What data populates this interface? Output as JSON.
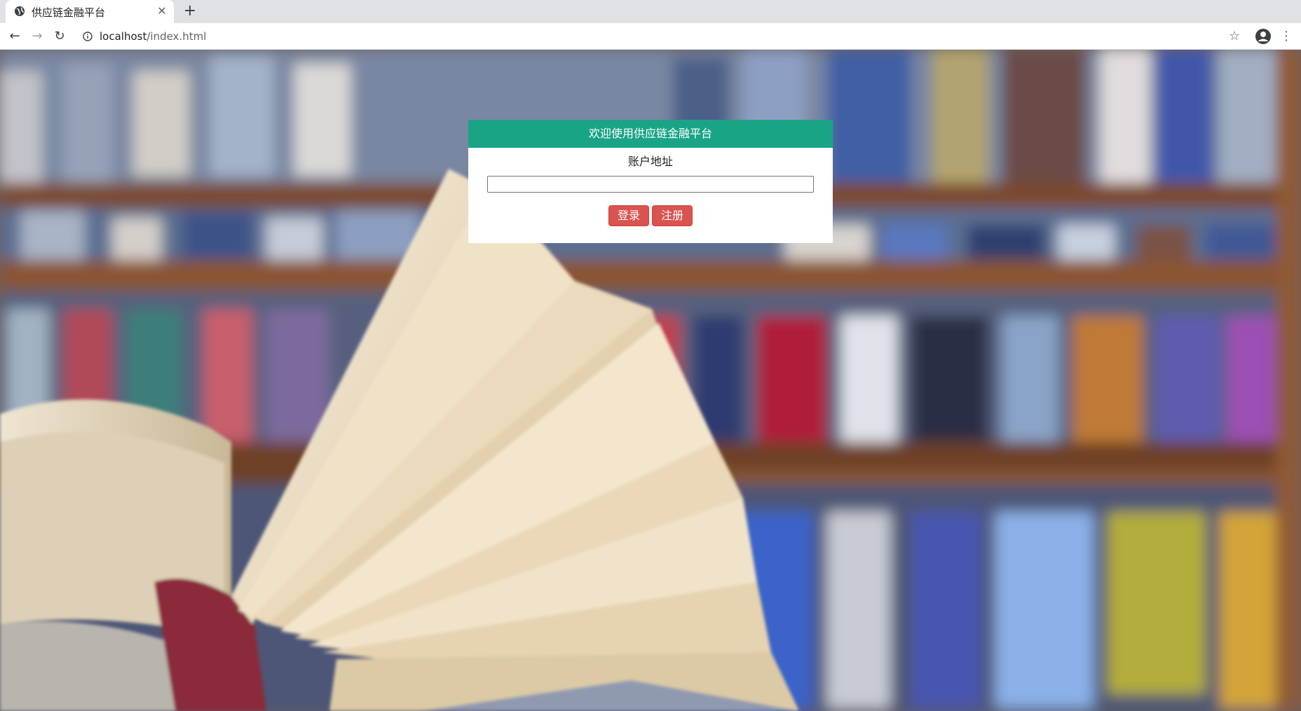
{
  "browser": {
    "tab_title": "供应链金融平台",
    "url_host": "localhost",
    "url_path": "/index.html",
    "icons": {
      "favicon": "globe-icon",
      "close": "close-icon",
      "new_tab": "plus-icon",
      "back": "arrow-left-icon",
      "forward": "arrow-right-icon",
      "reload": "reload-icon",
      "info": "info-icon",
      "bookmark": "star-icon",
      "account": "account-icon",
      "menu": "kebab-menu-icon"
    }
  },
  "page": {
    "background": "bookshelf-and-open-book-photo",
    "login": {
      "header": "欢迎使用供应链金融平台",
      "address_label": "账户地址",
      "address_value": "",
      "login_label": "登录",
      "register_label": "注册"
    }
  },
  "colors": {
    "header_green": "#1aa486",
    "button_red": "#d9534f"
  }
}
